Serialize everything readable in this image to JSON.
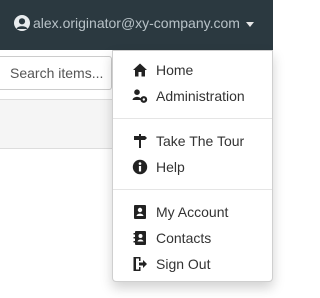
{
  "header": {
    "user_email": "alex.originator@xy-company.com",
    "user_icon": "user-avatar-icon",
    "caret_icon": "caret-down-icon"
  },
  "search": {
    "placeholder": "Search items..."
  },
  "user_menu": {
    "home": {
      "label": "Home",
      "icon": "home-icon"
    },
    "administration": {
      "label": "Administration",
      "icon": "users-cog-icon"
    },
    "take_tour": {
      "label": "Take The Tour",
      "icon": "signpost-icon"
    },
    "help": {
      "label": "Help",
      "icon": "info-icon"
    },
    "my_account": {
      "label": "My Account",
      "icon": "account-card-icon"
    },
    "contacts": {
      "label": "Contacts",
      "icon": "address-book-icon"
    },
    "sign_out": {
      "label": "Sign Out",
      "icon": "sign-out-icon"
    }
  },
  "colors": {
    "topbar_bg": "#2b3940",
    "header_text": "#b8c2c7",
    "menu_text": "#333333",
    "band_bg": "#f5f5f5"
  }
}
